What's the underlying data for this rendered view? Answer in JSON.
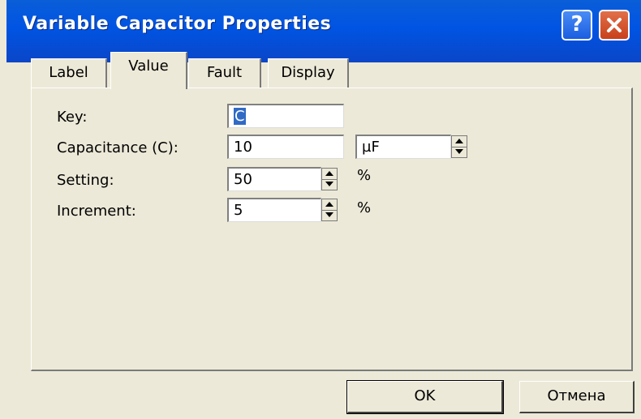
{
  "window": {
    "title": "Variable Capacitor Properties"
  },
  "title_buttons": {
    "help": "?"
  },
  "tabs": [
    {
      "label": "Label"
    },
    {
      "label": "Value"
    },
    {
      "label": "Fault"
    },
    {
      "label": "Display"
    }
  ],
  "form": {
    "key_label": "Key:",
    "key_value": "C",
    "capacitance_label": "Capacitance (C):",
    "capacitance_value": "10",
    "capacitance_unit": "µF",
    "setting_label": "Setting:",
    "setting_value": "50",
    "setting_unit": "%",
    "increment_label": "Increment:",
    "increment_value": "5",
    "increment_unit": "%"
  },
  "buttons": {
    "ok": "OK",
    "cancel": "Отмена"
  },
  "colors": {
    "titlebar": "#0054e3",
    "dialog_bg": "#ece9d8",
    "close_button": "#c8401a",
    "selection": "#316ac5"
  },
  "icons": {
    "help": "question-mark-icon",
    "close": "close-x-icon",
    "spin": "spinner-arrows-icon"
  }
}
